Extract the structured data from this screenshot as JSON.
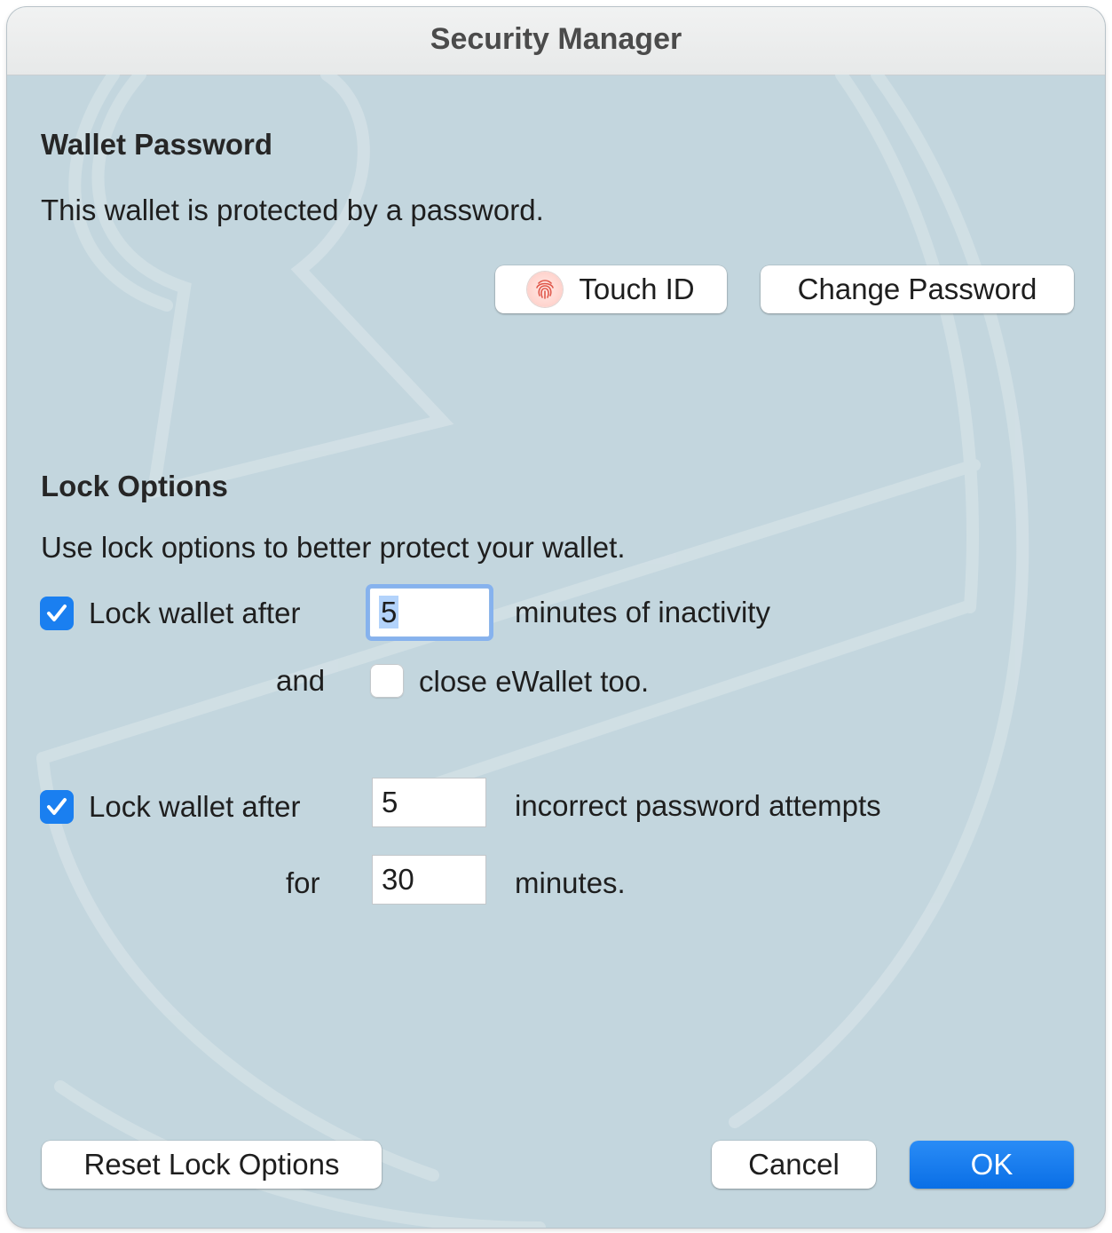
{
  "window": {
    "title": "Security Manager"
  },
  "wallet_password": {
    "heading": "Wallet Password",
    "description": "This wallet is protected by a password.",
    "touch_id_label": "Touch ID",
    "change_password_label": "Change Password"
  },
  "lock_options": {
    "heading": "Lock Options",
    "description": "Use lock options to better protect your wallet.",
    "inactivity": {
      "checked": true,
      "label": "Lock wallet after",
      "value": "5",
      "suffix": "minutes of inactivity"
    },
    "close_app": {
      "prefix": "and",
      "checked": false,
      "label": "close eWallet too."
    },
    "attempts": {
      "checked": true,
      "label": "Lock wallet after",
      "value": "5",
      "suffix": "incorrect password attempts"
    },
    "duration": {
      "prefix": "for",
      "value": "30",
      "suffix": "minutes."
    }
  },
  "footer": {
    "reset_label": "Reset Lock Options",
    "cancel_label": "Cancel",
    "ok_label": "OK"
  },
  "colors": {
    "background": "#c3d6de",
    "accent": "#1a7ff0",
    "titlebar": "#eceeee"
  },
  "icons": {
    "touch_id": "fingerprint-icon",
    "checkbox_checked": "checkmark-icon"
  }
}
